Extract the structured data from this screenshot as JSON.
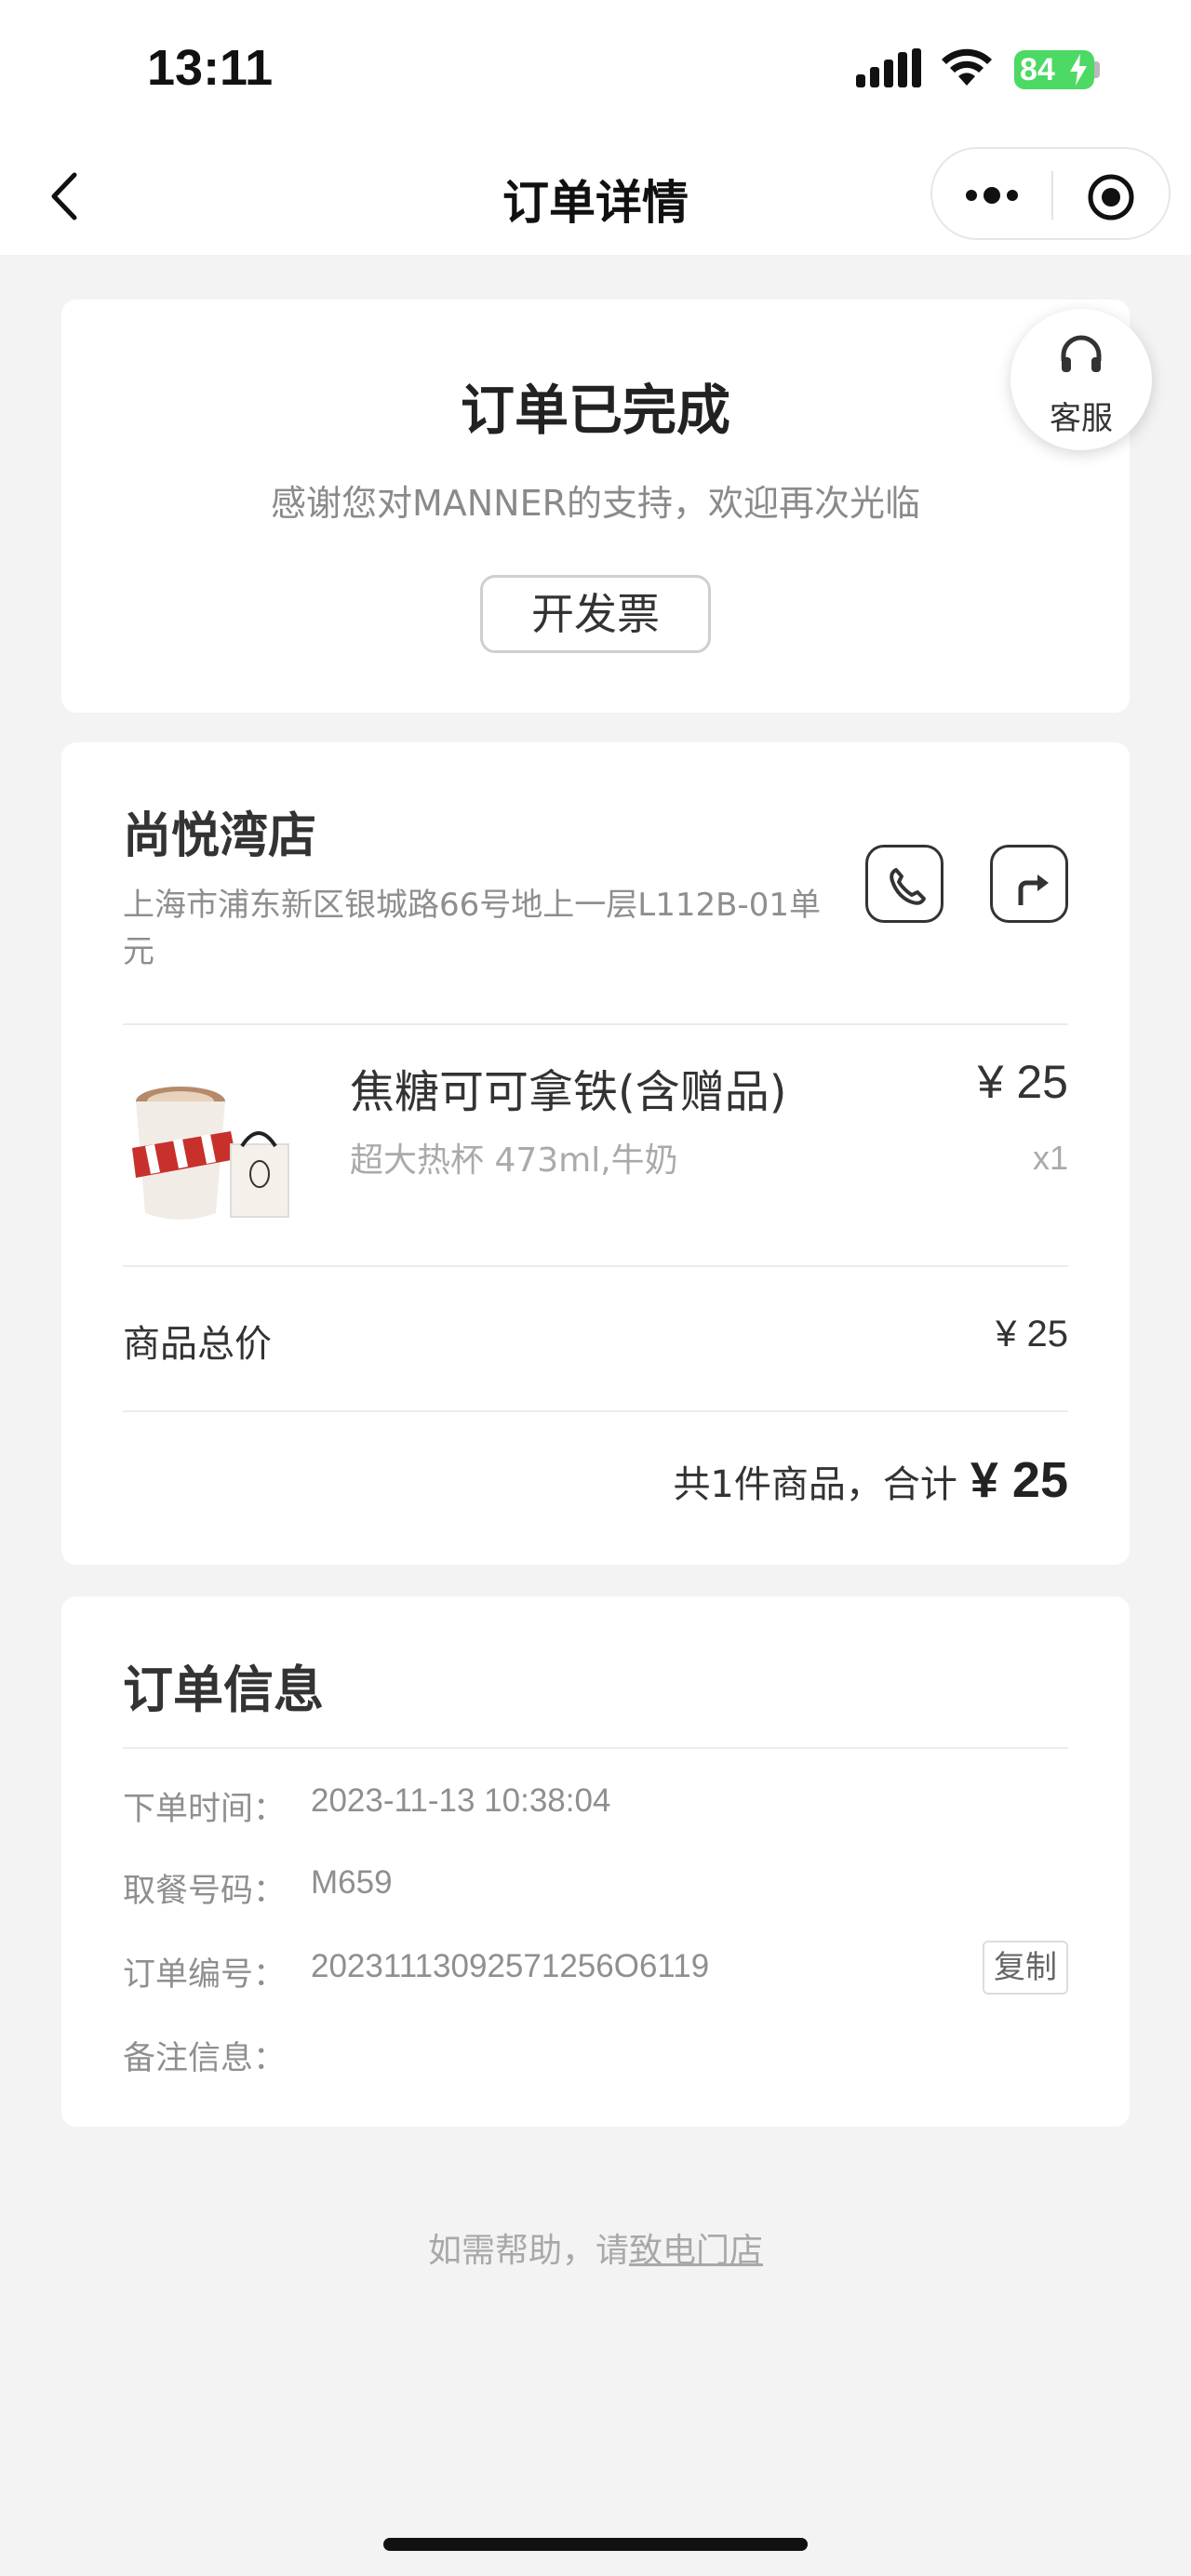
{
  "status_bar": {
    "time": "13:11",
    "battery": "84",
    "icons": [
      "signal-icon",
      "wifi-icon",
      "battery-icon"
    ]
  },
  "nav": {
    "title": "订单详情",
    "icons": [
      "back-arrow-icon",
      "more-icon",
      "close-target-icon"
    ]
  },
  "status_card": {
    "title": "订单已完成",
    "subtitle": "感谢您对MANNER的支持，欢迎再次光临",
    "invoice_button": "开发票"
  },
  "customer_service": {
    "label": "客服",
    "icon": "headset-icon"
  },
  "order_card": {
    "store_name": "尚悦湾店",
    "store_address": "上海市浦东新区银城路66号地上一层L112B-01单元",
    "icons": [
      "phone-icon",
      "navigation-icon"
    ],
    "product": {
      "name": "焦糖可可拿铁(含赠品)",
      "spec": "超大热杯 473ml,牛奶",
      "price": "¥ 25",
      "quantity": "x1"
    },
    "subtotal_label": "商品总价",
    "subtotal_value": "¥ 25",
    "total_label": "共1件商品，合计",
    "total_value": "¥ 25"
  },
  "order_info": {
    "title": "订单信息",
    "rows": [
      {
        "label": "下单时间：",
        "value": "2023-11-13 10:38:04"
      },
      {
        "label": "取餐号码：",
        "value": "M659"
      },
      {
        "label": "订单编号：",
        "value": "20231113092571256O6119"
      },
      {
        "label": "备注信息：",
        "value": ""
      }
    ],
    "copy_button": "复制"
  },
  "footer": {
    "help_prefix": "如需帮助，请",
    "help_link": "致电门店"
  },
  "colors": {
    "background": "#f3f3f3",
    "card": "#ffffff",
    "battery": "#4cd964",
    "text_primary": "#333333",
    "text_secondary": "#8e8e8e"
  }
}
